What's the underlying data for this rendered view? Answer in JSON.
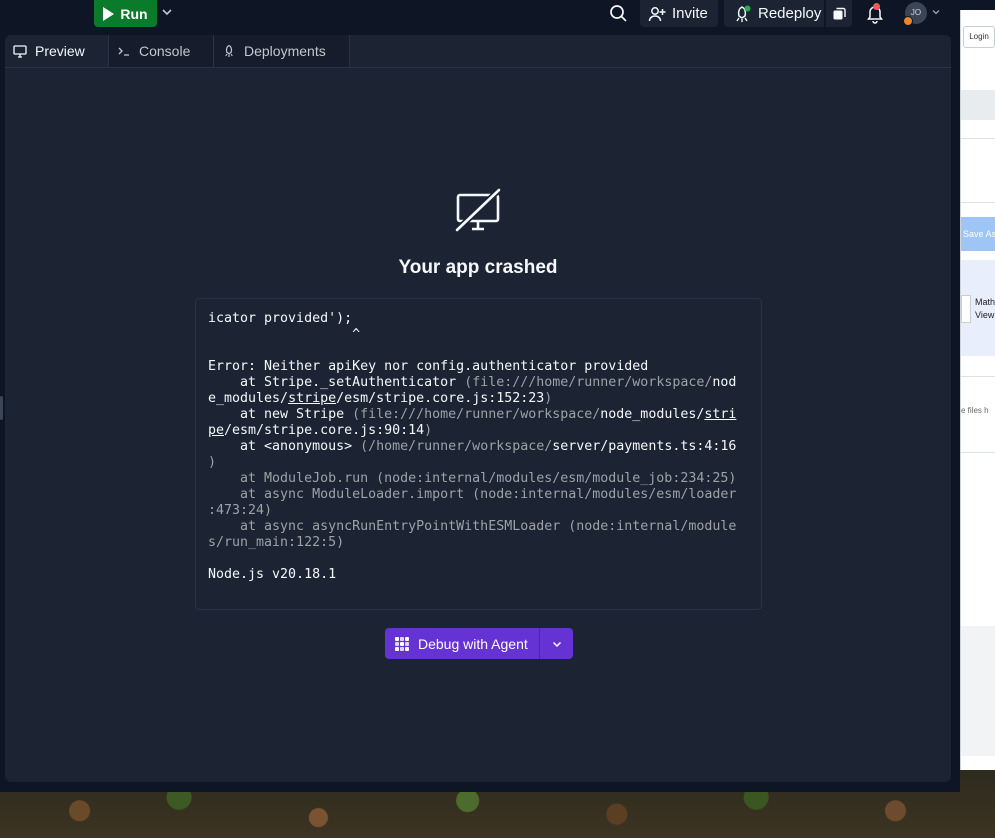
{
  "topbar": {
    "run_label": "Run",
    "invite_label": "Invite",
    "redeploy_label": "Redeploy",
    "avatar_initials": "JO"
  },
  "tabs": [
    {
      "label": "Preview",
      "active": true
    },
    {
      "label": "Console",
      "active": false
    },
    {
      "label": "Deployments",
      "active": false
    }
  ],
  "crash": {
    "title": "Your app crashed",
    "debug_label": "Debug with Agent"
  },
  "log": {
    "l1": "icator provided');",
    "l2": "                  ^",
    "l3": "Error: Neither apiKey nor config.authenticator provided",
    "l4a": "    at Stripe._setAuthenticator ",
    "l4b": "(file:///home/runner/workspace/",
    "l4c": "nod",
    "l5a": "e_modules/",
    "l5b": "stripe",
    "l5c": "/esm/stripe.core.js:152:23",
    "l5d": ")",
    "l6a": "    at new Stripe ",
    "l6b": "(file:///home/runner/workspace/",
    "l6c": "node_modules/",
    "l6d": "stri",
    "l7a": "pe",
    "l7b": "/esm/stripe.core.js:90:14",
    "l7c": ")",
    "l8a": "    at <anonymous> ",
    "l8b": "(/home/runner/workspace/",
    "l8c": "server/payments.ts:4:16",
    "l9": ")",
    "l10": "    at ModuleJob.run (node:internal/modules/esm/module_job:234:25)",
    "l11": "    at async ModuleLoader.import (node:internal/modules/esm/loader",
    "l12": ":473:24)",
    "l13": "    at async asyncRunEntryPointWithESMLoader (node:internal/module",
    "l14": "s/run_main:122:5)",
    "l15": "",
    "l16": "Node.js v20.18.1"
  },
  "background": {
    "login": "Login",
    "save": "Save As",
    "math1": "Math",
    "math2": "View",
    "files": "e files h"
  },
  "colors": {
    "run_green": "#0a7a2b",
    "agent_purple": "#6533d4",
    "pane_bg": "#1c2333",
    "app_bg": "#0e1525"
  }
}
